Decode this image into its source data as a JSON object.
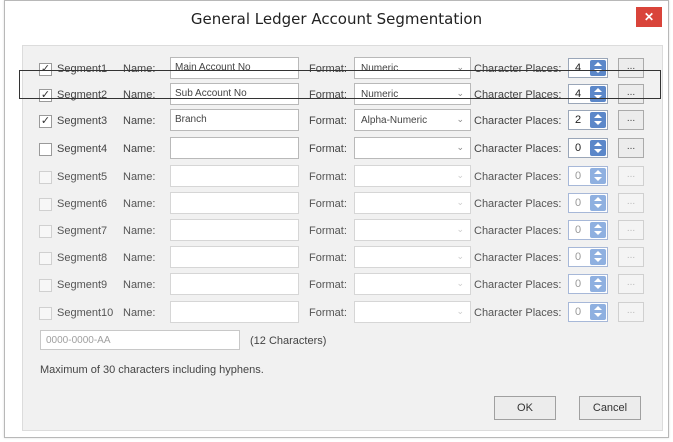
{
  "window": {
    "title": "General Ledger Account Segmentation",
    "close_glyph": "✕"
  },
  "labels": {
    "name": "Name:",
    "format": "Format:",
    "char_places": "Character Places:",
    "ellipsis": "..."
  },
  "segments": [
    {
      "label": "Segment1",
      "checked": true,
      "enabled": true,
      "name": "Main Account No",
      "format": "Numeric",
      "places": "4"
    },
    {
      "label": "Segment2",
      "checked": true,
      "enabled": true,
      "name": "Sub Account No",
      "format": "Numeric",
      "places": "4"
    },
    {
      "label": "Segment3",
      "checked": true,
      "enabled": true,
      "name": "Branch",
      "format": "Alpha-Numeric",
      "places": "2"
    },
    {
      "label": "Segment4",
      "checked": false,
      "enabled": true,
      "name": "",
      "format": "",
      "places": "0"
    },
    {
      "label": "Segment5",
      "checked": false,
      "enabled": false,
      "name": "",
      "format": "",
      "places": "0"
    },
    {
      "label": "Segment6",
      "checked": false,
      "enabled": false,
      "name": "",
      "format": "",
      "places": "0"
    },
    {
      "label": "Segment7",
      "checked": false,
      "enabled": false,
      "name": "",
      "format": "",
      "places": "0"
    },
    {
      "label": "Segment8",
      "checked": false,
      "enabled": false,
      "name": "",
      "format": "",
      "places": "0"
    },
    {
      "label": "Segment9",
      "checked": false,
      "enabled": false,
      "name": "",
      "format": "",
      "places": "0"
    },
    {
      "label": "Segment10",
      "checked": false,
      "enabled": false,
      "name": "",
      "format": "",
      "places": "0"
    }
  ],
  "preview": {
    "mask": "0000-0000-AA",
    "char_count": "(12 Characters)"
  },
  "note": "Maximum of 30 characters including hyphens.",
  "buttons": {
    "ok": "OK",
    "cancel": "Cancel"
  }
}
